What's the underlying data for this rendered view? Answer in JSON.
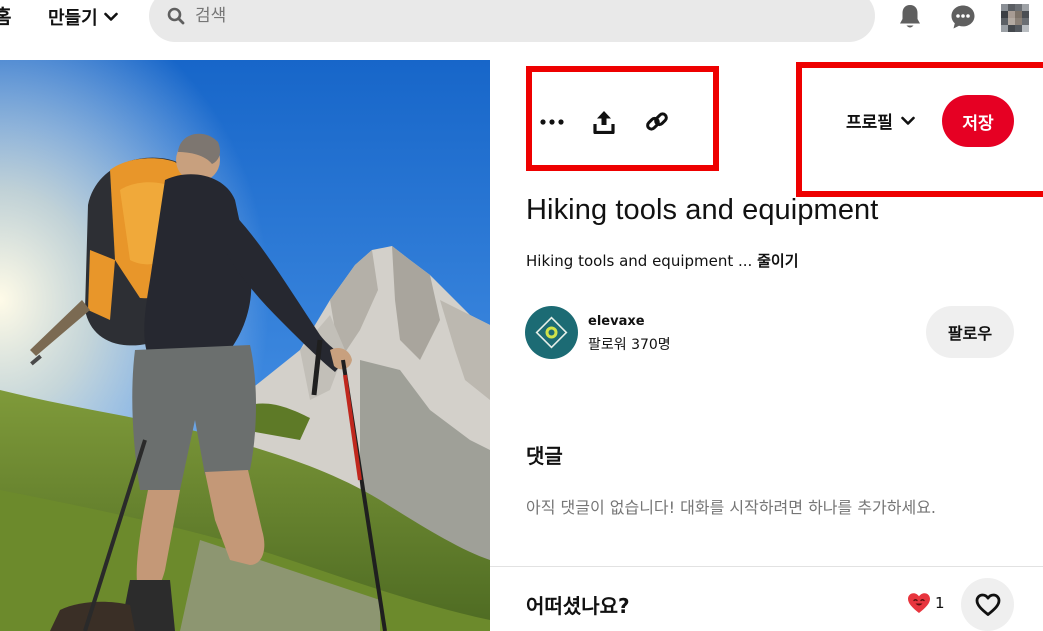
{
  "topbar": {
    "nav_cut_label": "홈",
    "create_label": "만들기",
    "search_placeholder": "검색",
    "icons": [
      "bell-icon",
      "chat-icon",
      "profile-avatar"
    ]
  },
  "pin": {
    "title": "Hiking tools and equipment",
    "description": "Hiking tools and equipment ...",
    "collapse_label": "줄이기",
    "save_label": "저장",
    "board_select_label": "프로필",
    "action_icons": [
      "more-icon",
      "share-icon",
      "link-icon"
    ]
  },
  "creator": {
    "name": "elevaxe",
    "followers": "팔로워 370명",
    "follow_label": "팔로우"
  },
  "comments": {
    "title": "댓글",
    "empty_text": "아직 댓글이 없습니다! 대화를 시작하려면 하나를 추가하세요."
  },
  "feedback": {
    "question": "어떠셨나요?",
    "reaction_count": "1"
  },
  "colors": {
    "save_red": "#e60023",
    "highlight_red": "#ee0000",
    "creator_teal": "#1c6b74",
    "search_bg": "#e9e9e9",
    "button_gray": "#efefef",
    "sky_blue": "#1766c9"
  }
}
